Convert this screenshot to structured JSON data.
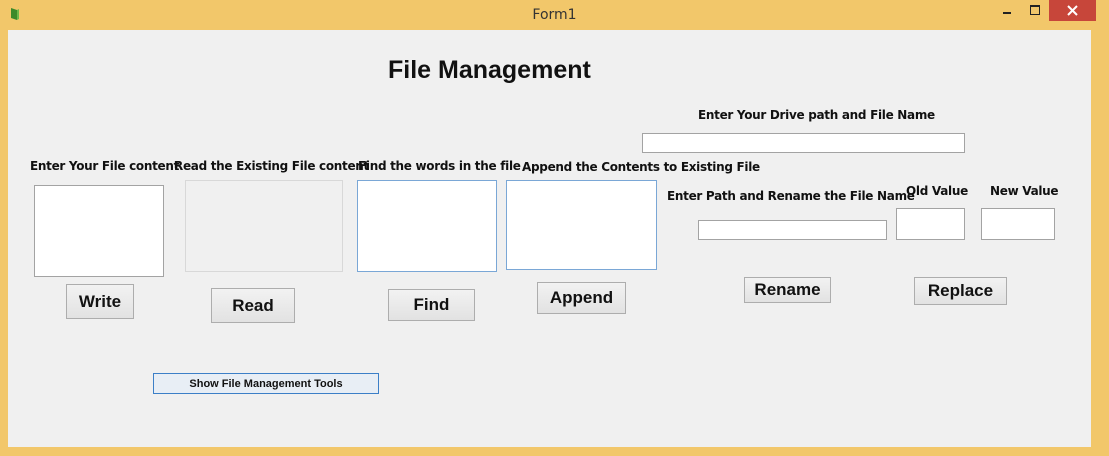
{
  "window": {
    "title": "Form1"
  },
  "heading": "File Management",
  "labels": {
    "drive_path": "Enter Your Drive path and File Name",
    "file_content": "Enter Your File content",
    "read_existing": "Read the Existing File content",
    "find_words": "Find the words in the file",
    "append_contents": "Append the Contents to Existing File",
    "rename_path": "Enter Path and Rename the File Name",
    "old_value": "Old Value",
    "new_value": "New Value"
  },
  "inputs": {
    "drive_path": "",
    "file_content": "",
    "read_content": "",
    "find_words": "",
    "append_content": "",
    "rename_path": "",
    "old_value": "",
    "new_value": ""
  },
  "buttons": {
    "write": "Write",
    "read": "Read",
    "find": "Find",
    "append": "Append",
    "rename": "Rename",
    "replace": "Replace",
    "show_tools": "Show File Management Tools"
  },
  "colors": {
    "title_bar": "#f2c76a",
    "close_button": "#c7463a",
    "form_background": "#f0f0f0"
  }
}
